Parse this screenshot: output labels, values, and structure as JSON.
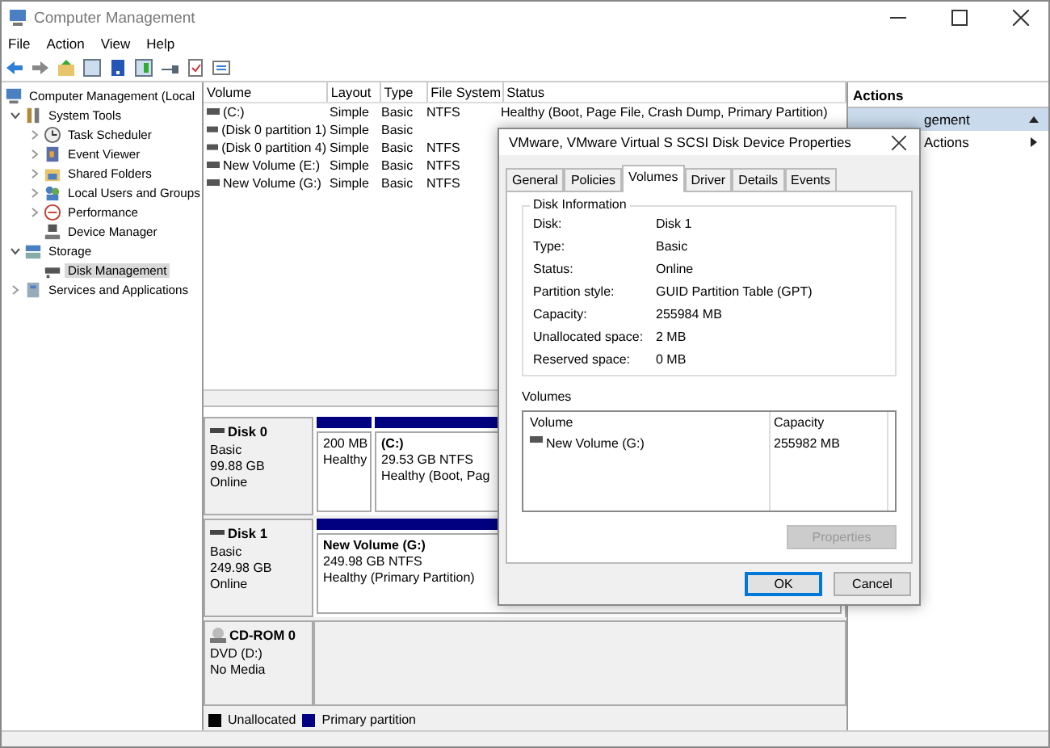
{
  "window": {
    "title": "Computer Management"
  },
  "menu": [
    {
      "label": "File"
    },
    {
      "label": "Action"
    },
    {
      "label": "View"
    },
    {
      "label": "Help"
    }
  ],
  "tree": [
    {
      "label": "Computer Management (Local",
      "selected": false,
      "children": [
        {
          "label": "System Tools",
          "expanded": true,
          "selected": false,
          "children": [
            {
              "label": "Task Scheduler",
              "expanded": false,
              "selected": false
            },
            {
              "label": "Event Viewer",
              "expanded": false,
              "selected": false
            },
            {
              "label": "Shared Folders",
              "expanded": false,
              "selected": false
            },
            {
              "label": "Local Users and Groups",
              "expanded": false,
              "selected": false
            },
            {
              "label": "Performance",
              "expanded": false,
              "selected": false
            },
            {
              "label": "Device Manager",
              "selected": false
            }
          ]
        },
        {
          "label": "Storage",
          "expanded": true,
          "selected": false,
          "children": [
            {
              "label": "Disk Management",
              "selected": true
            }
          ]
        },
        {
          "label": "Services and Applications",
          "expanded": false,
          "selected": false
        }
      ]
    }
  ],
  "volume_table": {
    "columns": [
      "Volume",
      "Layout",
      "Type",
      "File System",
      "Status"
    ],
    "rows": [
      {
        "cells": [
          "(C:)",
          "Simple",
          "Basic",
          "NTFS",
          "Healthy (Boot, Page File, Crash Dump, Primary Partition)"
        ]
      },
      {
        "cells": [
          "(Disk 0 partition 1)",
          "Simple",
          "Basic"
        ]
      },
      {
        "cells": [
          "(Disk 0 partition 4)",
          "Simple",
          "Basic",
          "NTFS"
        ]
      },
      {
        "cells": [
          "New Volume (E:)",
          "Simple",
          "Basic",
          "NTFS"
        ]
      },
      {
        "cells": [
          "New Volume (G:)",
          "Simple",
          "Basic",
          "NTFS"
        ]
      }
    ]
  },
  "disks": [
    {
      "kind": "disk",
      "name": "Disk 0",
      "lines": [
        "Basic",
        "99.88 GB",
        "Online"
      ],
      "partitions": [
        {
          "size": "200 MB",
          "status": "Healthy",
          "color": "#000080"
        },
        {
          "name": "(C:)",
          "size": "29.53 GB NTFS",
          "status": "Healthy (Boot, Pag",
          "color": "#000080"
        }
      ]
    },
    {
      "kind": "disk",
      "name": "Disk 1",
      "lines": [
        "Basic",
        "249.98 GB",
        "Online"
      ],
      "partitions": [
        {
          "name": "New Volume  (G:)",
          "size": "249.98 GB NTFS",
          "status": "Healthy (Primary Partition)",
          "color": "#000080"
        }
      ]
    },
    {
      "kind": "cdrom",
      "name": "CD-ROM 0",
      "lines": [
        "DVD (D:)",
        "No Media"
      ]
    }
  ],
  "legend": [
    {
      "label": "Unallocated",
      "color": "#000000"
    },
    {
      "label": "Primary partition",
      "color": "#000080"
    }
  ],
  "actions": {
    "title": "Actions",
    "items": [
      {
        "kind": "section",
        "label": "gement"
      },
      {
        "kind": "submenu",
        "label": "Actions"
      }
    ]
  },
  "dialog": {
    "title": "VMware, VMware Virtual S SCSI Disk Device Properties",
    "tabs": [
      {
        "label": "General",
        "selected": false
      },
      {
        "label": "Policies",
        "selected": false
      },
      {
        "label": "Volumes",
        "selected": true
      },
      {
        "label": "Driver",
        "selected": false
      },
      {
        "label": "Details",
        "selected": false
      },
      {
        "label": "Events",
        "selected": false
      }
    ],
    "disk_info": {
      "title": "Disk Information",
      "fields": [
        {
          "label": "Disk:",
          "value": "Disk 1"
        },
        {
          "label": "Type:",
          "value": "Basic"
        },
        {
          "label": "Status:",
          "value": "Online"
        },
        {
          "label": "Partition style:",
          "value": "GUID Partition Table (GPT)"
        },
        {
          "label": "Capacity:",
          "value": "255984 MB"
        },
        {
          "label": "Unallocated space:",
          "value": "2 MB"
        },
        {
          "label": "Reserved space:",
          "value": "0 MB"
        }
      ]
    },
    "volumes": {
      "title": "Volumes",
      "columns": [
        "Volume",
        "Capacity"
      ],
      "rows": [
        {
          "cells": [
            "New Volume (G:)",
            "255982 MB"
          ]
        }
      ]
    },
    "properties_button": {
      "label": "Properties",
      "disabled": true
    },
    "buttons": [
      {
        "label": "OK",
        "default": true
      },
      {
        "label": "Cancel",
        "default": false
      }
    ]
  }
}
